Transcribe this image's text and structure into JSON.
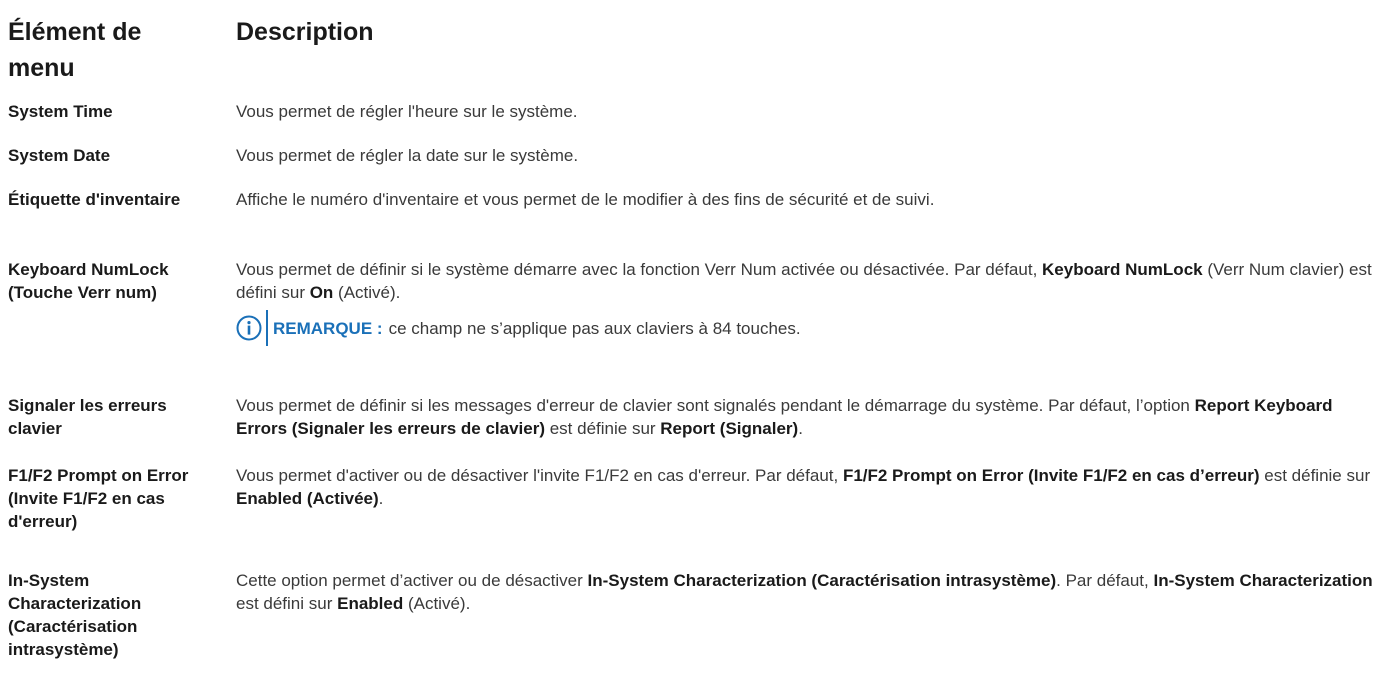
{
  "header": {
    "col1": "Élément de menu",
    "col2": "Description"
  },
  "rows": [
    {
      "item": "System Time",
      "desc": [
        {
          "t": "Vous permet de régler l'heure sur le système."
        }
      ]
    },
    {
      "item": "System Date",
      "desc": [
        {
          "t": "Vous permet de régler la date sur le système."
        }
      ]
    },
    {
      "item": "Étiquette d'inventaire",
      "desc": [
        {
          "t": "Affiche le numéro d'inventaire et vous permet de le modifier à des fins de sécurité et de suivi."
        }
      ]
    },
    {
      "item": "Keyboard NumLock (Touche Verr num)",
      "desc": [
        {
          "t": "Vous permet de définir si le système démarre avec la fonction Verr Num activée ou désactivée. Par défaut, "
        },
        {
          "b": "Keyboard NumLock"
        },
        {
          "t": " (Verr Num clavier) est défini sur "
        },
        {
          "b": "On"
        },
        {
          "t": " (Activé)."
        }
      ],
      "note": {
        "icon": "info-icon",
        "label": "REMARQUE :",
        "text": "ce champ ne s’applique pas aux claviers à 84 touches."
      }
    },
    {
      "item": "Signaler les erreurs clavier",
      "desc": [
        {
          "t": "Vous permet de définir si les messages d'erreur de clavier sont signalés pendant le démarrage du système. Par défaut, l’option "
        },
        {
          "b": "Report Keyboard Errors (Signaler les erreurs de clavier)"
        },
        {
          "t": " est définie sur "
        },
        {
          "b": "Report (Signaler)"
        },
        {
          "t": "."
        }
      ]
    },
    {
      "item": "F1/F2 Prompt on Error (Invite F1/F2 en cas d'erreur)",
      "desc": [
        {
          "t": "Vous permet d'activer ou de désactiver l'invite F1/F2 en cas d'erreur. Par défaut, "
        },
        {
          "b": "F1/F2 Prompt on Error (Invite F1/F2 en cas d’erreur)"
        },
        {
          "t": " est définie sur "
        },
        {
          "b": "Enabled (Activée)"
        },
        {
          "t": "."
        }
      ]
    },
    {
      "item": "In-System Characterization (Caractérisation intrasystème)",
      "desc": [
        {
          "t": "Cette option permet d’activer ou de désactiver "
        },
        {
          "b": "In-System Characterization (Caractérisation intrasystème)"
        },
        {
          "t": ". Par défaut, "
        },
        {
          "b": "In-System Characterization"
        },
        {
          "t": " est défini sur "
        },
        {
          "b": "Enabled"
        },
        {
          "t": " (Activé)."
        }
      ]
    }
  ],
  "colors": {
    "accent": "#1a70b8",
    "text": "#3a3a3a",
    "bold": "#1a1a1a"
  }
}
